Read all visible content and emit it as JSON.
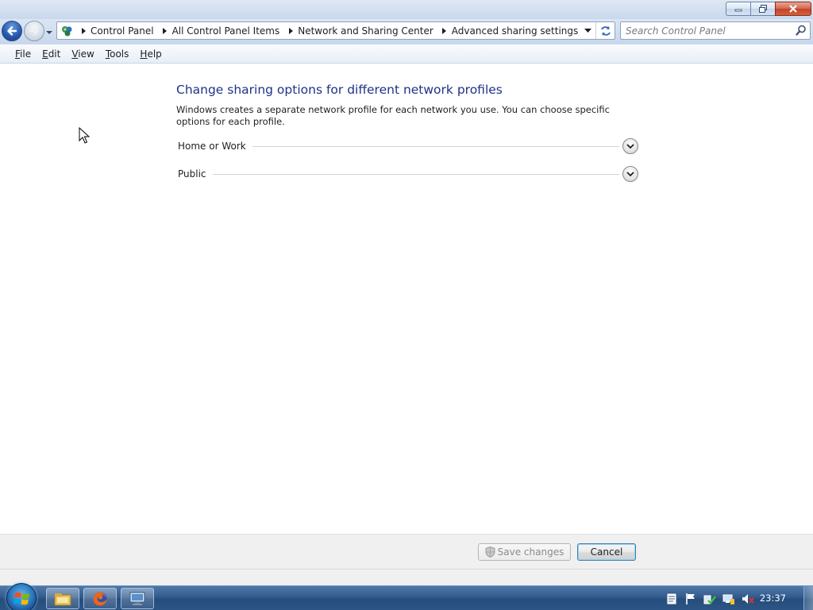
{
  "window": {
    "caption_buttons": [
      "minimize-icon",
      "restore-icon",
      "close-icon"
    ]
  },
  "navigation": {
    "back_icon": "back-arrow-icon",
    "forward_icon": "forward-arrow-icon",
    "recent_icon": "chevron-down-icon"
  },
  "breadcrumb": {
    "root_icon": "control-panel-icon",
    "items": [
      {
        "label": "Control Panel"
      },
      {
        "label": "All Control Panel Items"
      },
      {
        "label": "Network and Sharing Center"
      },
      {
        "label": "Advanced sharing settings"
      }
    ]
  },
  "search": {
    "placeholder": "Search Control Panel",
    "value": ""
  },
  "menu": {
    "items": [
      {
        "accel": "F",
        "rest": "ile"
      },
      {
        "accel": "E",
        "rest": "dit"
      },
      {
        "accel": "V",
        "rest": "iew"
      },
      {
        "accel": "T",
        "rest": "ools"
      },
      {
        "accel": "H",
        "rest": "elp"
      }
    ]
  },
  "main": {
    "heading": "Change sharing options for different network profiles",
    "description": "Windows creates a separate network profile for each network you use. You can choose specific options for each profile.",
    "profiles": [
      {
        "name": "Home or Work",
        "expanded": false
      },
      {
        "name": "Public",
        "expanded": false
      }
    ]
  },
  "buttons": {
    "save_label": "Save changes",
    "save_enabled": false,
    "cancel_label": "Cancel"
  },
  "taskbar": {
    "pinned": [
      "explorer-icon",
      "firefox-icon",
      "network-app-icon"
    ],
    "tray_icons": [
      "notepad-icon",
      "action-center-flag-icon",
      "security-check-icon",
      "network-icon",
      "volume-muted-icon"
    ],
    "clock": "23:37"
  },
  "colors": {
    "heading": "#1e3287",
    "taskbar": "#2c5585",
    "cancel_focus_border": "#3c7fb1"
  }
}
